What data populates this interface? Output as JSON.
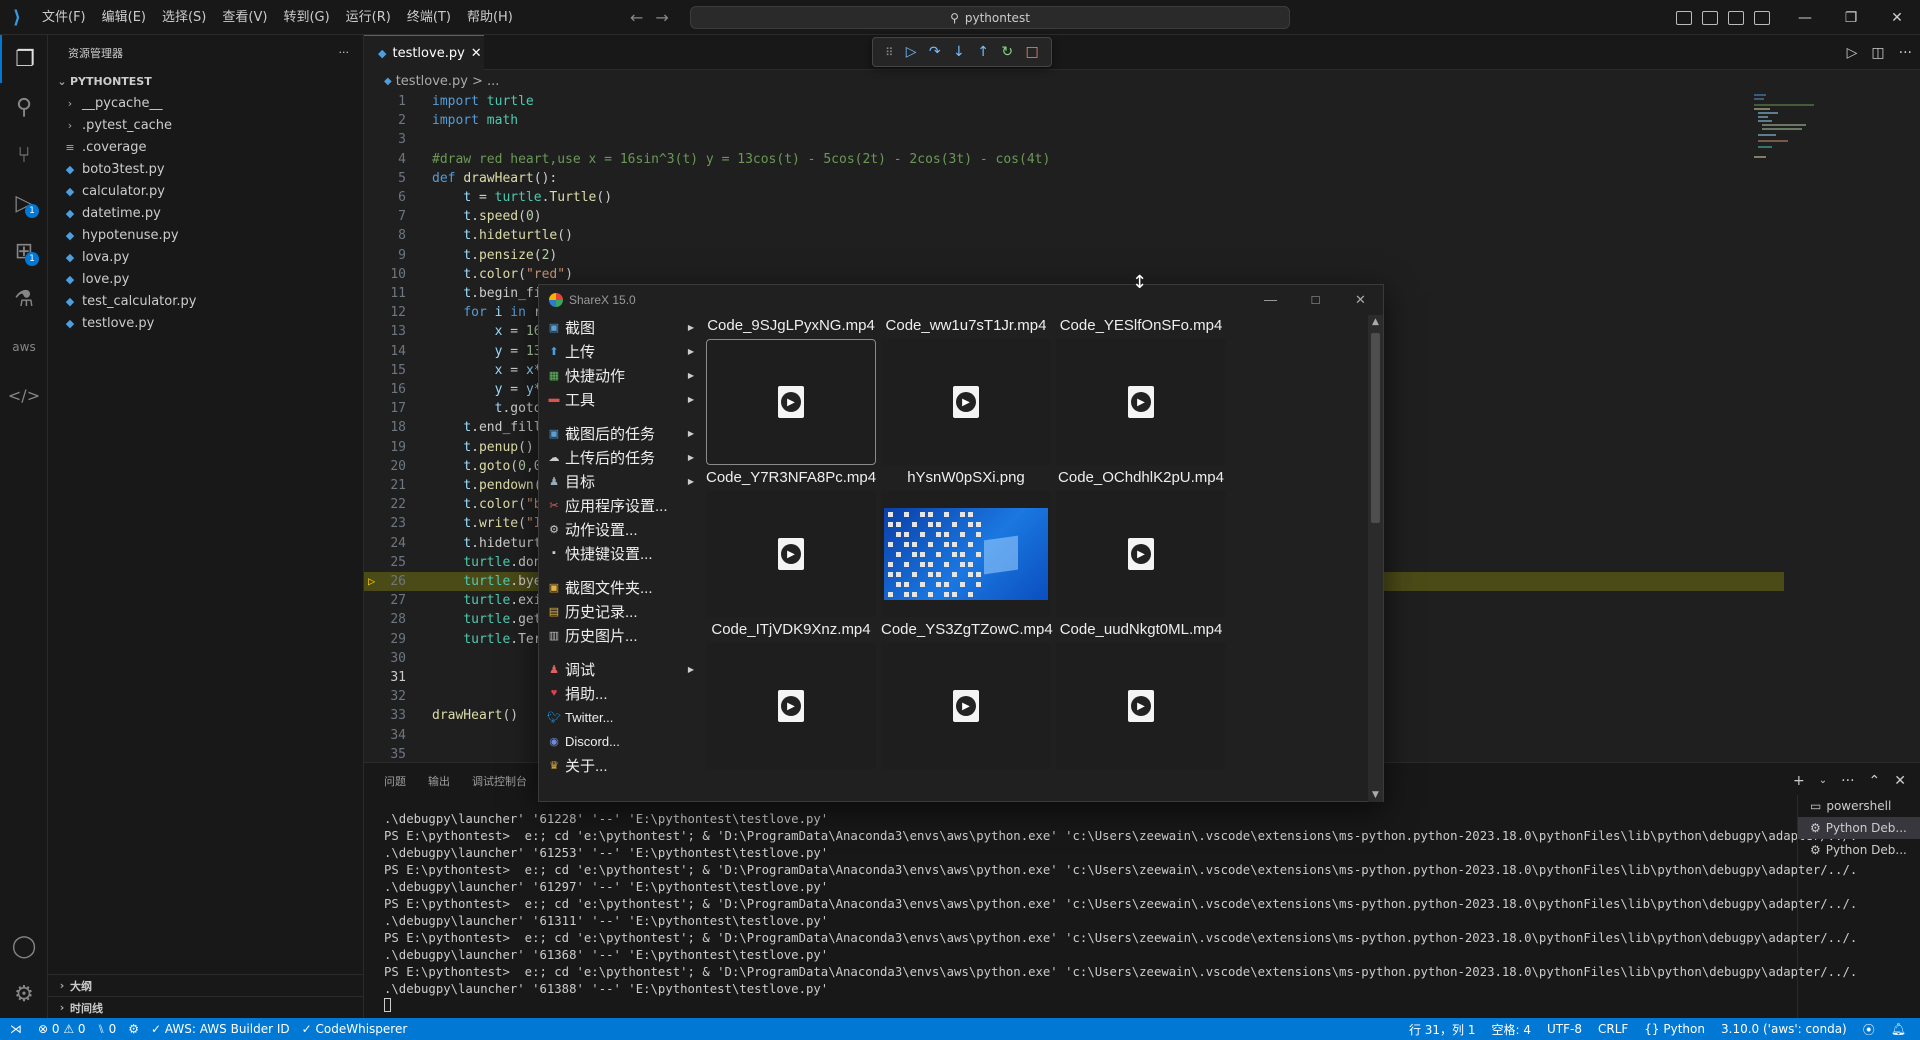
{
  "titlebar": {
    "menus": [
      "文件(F)",
      "编辑(E)",
      "选择(S)",
      "查看(V)",
      "转到(G)",
      "运行(R)",
      "终端(T)",
      "帮助(H)"
    ],
    "search": "pythontest"
  },
  "activity": {
    "debug_badge": "1",
    "ext_badge": "1"
  },
  "explorer": {
    "header": "资源管理器",
    "folder": "PYTHONTEST",
    "items": [
      {
        "name": "__pycache__",
        "type": "folder"
      },
      {
        "name": ".pytest_cache",
        "type": "folder"
      },
      {
        "name": ".coverage",
        "type": "file"
      },
      {
        "name": "boto3test.py",
        "type": "py"
      },
      {
        "name": "calculator.py",
        "type": "py"
      },
      {
        "name": "datetime.py",
        "type": "py"
      },
      {
        "name": "hypotenuse.py",
        "type": "py"
      },
      {
        "name": "lova.py",
        "type": "py"
      },
      {
        "name": "love.py",
        "type": "py"
      },
      {
        "name": "test_calculator.py",
        "type": "py"
      },
      {
        "name": "testlove.py",
        "type": "py"
      }
    ],
    "outline": "大纲",
    "timeline": "时间线"
  },
  "editor": {
    "tab": "testlove.py",
    "breadcrumb_file": "testlove.py",
    "breadcrumb_rest": "> ...",
    "current_line": 31,
    "highlight_line": 26,
    "lines": [
      "import turtle",
      "import math",
      "",
      "#draw red heart,use x = 16sin^3(t) y = 13cos(t) - 5cos(2t) - 2cos(3t) - cos(4t)",
      "def drawHeart():",
      "    t = turtle.Turtle()",
      "    t.speed(0)",
      "    t.hideturtle()",
      "    t.pensize(2)",
      "    t.color(\"red\")",
      "    t.begin_fi",
      "    for i in r",
      "        x = 16",
      "        y = 13",
      "        x = x*",
      "        y = y*",
      "        t.goto",
      "    t.end_fill",
      "    t.penup()",
      "    t.goto(0,0",
      "    t.pendown(",
      "    t.color(\"b",
      "    t.write(\"I",
      "    t.hideturt",
      "    turtle.don",
      "    turtle.bye",
      "    turtle.exi",
      "    turtle.get",
      "    turtle.Ter",
      "",
      "",
      "",
      "drawHeart()",
      "",
      ""
    ]
  },
  "panel": {
    "tabs": [
      "问题",
      "输出",
      "调试控制台"
    ],
    "terminal_lines": [
      ".\\debugpy\\launcher' '61228' '--' 'E:\\pythontest\\testlove.py'",
      "PS E:\\pythontest>  e:; cd 'e:\\pythontest'; & 'D:\\ProgramData\\Anaconda3\\envs\\aws\\python.exe' 'c:\\Users\\zeewain\\.vscode\\extensions\\ms-python.python-2023.18.0\\pythonFiles\\lib\\python\\debugpy\\adapter/../.",
      ".\\debugpy\\launcher' '61253' '--' 'E:\\pythontest\\testlove.py'",
      "PS E:\\pythontest>  e:; cd 'e:\\pythontest'; & 'D:\\ProgramData\\Anaconda3\\envs\\aws\\python.exe' 'c:\\Users\\zeewain\\.vscode\\extensions\\ms-python.python-2023.18.0\\pythonFiles\\lib\\python\\debugpy\\adapter/../.",
      ".\\debugpy\\launcher' '61297' '--' 'E:\\pythontest\\testlove.py'",
      "PS E:\\pythontest>  e:; cd 'e:\\pythontest'; & 'D:\\ProgramData\\Anaconda3\\envs\\aws\\python.exe' 'c:\\Users\\zeewain\\.vscode\\extensions\\ms-python.python-2023.18.0\\pythonFiles\\lib\\python\\debugpy\\adapter/../.",
      ".\\debugpy\\launcher' '61311' '--' 'E:\\pythontest\\testlove.py'",
      "PS E:\\pythontest>  e:; cd 'e:\\pythontest'; & 'D:\\ProgramData\\Anaconda3\\envs\\aws\\python.exe' 'c:\\Users\\zeewain\\.vscode\\extensions\\ms-python.python-2023.18.0\\pythonFiles\\lib\\python\\debugpy\\adapter/../.",
      ".\\debugpy\\launcher' '61368' '--' 'E:\\pythontest\\testlove.py'",
      "PS E:\\pythontest>  e:; cd 'e:\\pythontest'; & 'D:\\ProgramData\\Anaconda3\\envs\\aws\\python.exe' 'c:\\Users\\zeewain\\.vscode\\extensions\\ms-python.python-2023.18.0\\pythonFiles\\lib\\python\\debugpy\\adapter/../.",
      ".\\debugpy\\launcher' '61388' '--' 'E:\\pythontest\\testlove.py'"
    ],
    "terminals": [
      "powershell",
      "Python Deb...",
      "Python Deb..."
    ]
  },
  "statusbar": {
    "errors": "0",
    "warnings": "0",
    "ports": "0",
    "aws": "AWS: AWS Builder ID",
    "codewhisperer": "CodeWhisperer",
    "position": "行 31，列 1",
    "spaces": "空格: 4",
    "encoding": "UTF-8",
    "eol": "CRLF",
    "language": "Python",
    "interpreter": "3.10.0 ('aws': conda)"
  },
  "sharex": {
    "title": "ShareX 15.0",
    "menu": [
      {
        "label": "截图",
        "arrow": true
      },
      {
        "label": "上传",
        "arrow": true
      },
      {
        "label": "快捷动作",
        "arrow": true
      },
      {
        "label": "工具",
        "arrow": true
      },
      {
        "sep": true
      },
      {
        "label": "截图后的任务",
        "arrow": true
      },
      {
        "label": "上传后的任务",
        "arrow": true
      },
      {
        "label": "目标",
        "arrow": true
      },
      {
        "label": "应用程序设置...",
        "arrow": false
      },
      {
        "label": "动作设置...",
        "arrow": false
      },
      {
        "label": "快捷键设置...",
        "arrow": false
      },
      {
        "sep": true
      },
      {
        "label": "截图文件夹...",
        "arrow": false
      },
      {
        "label": "历史记录...",
        "arrow": false
      },
      {
        "label": "历史图片...",
        "arrow": false
      },
      {
        "sep": true
      },
      {
        "label": "调试",
        "arrow": true
      },
      {
        "label": "捐助...",
        "arrow": false
      },
      {
        "label": "Twitter...",
        "arrow": false,
        "small": true
      },
      {
        "label": "Discord...",
        "arrow": false,
        "small": true
      },
      {
        "label": "关于...",
        "arrow": false
      }
    ],
    "files": [
      {
        "name": "Code_9SJgLPyxNG.mp4",
        "kind": "video",
        "selected": true
      },
      {
        "name": "Code_ww1u7sT1Jr.mp4",
        "kind": "video"
      },
      {
        "name": "Code_YESlfOnSFo.mp4",
        "kind": "video"
      },
      {
        "name": "Code_Y7R3NFA8Pc.mp4",
        "kind": "video"
      },
      {
        "name": "hYsnW0pSXi.png",
        "kind": "image"
      },
      {
        "name": "Code_OChdhlK2pU.mp4",
        "kind": "video"
      },
      {
        "name": "Code_ITjVDK9Xnz.mp4",
        "kind": "video"
      },
      {
        "name": "Code_YS3ZgTZowC.mp4",
        "kind": "video"
      },
      {
        "name": "Code_uudNkgt0ML.mp4",
        "kind": "video"
      }
    ]
  }
}
